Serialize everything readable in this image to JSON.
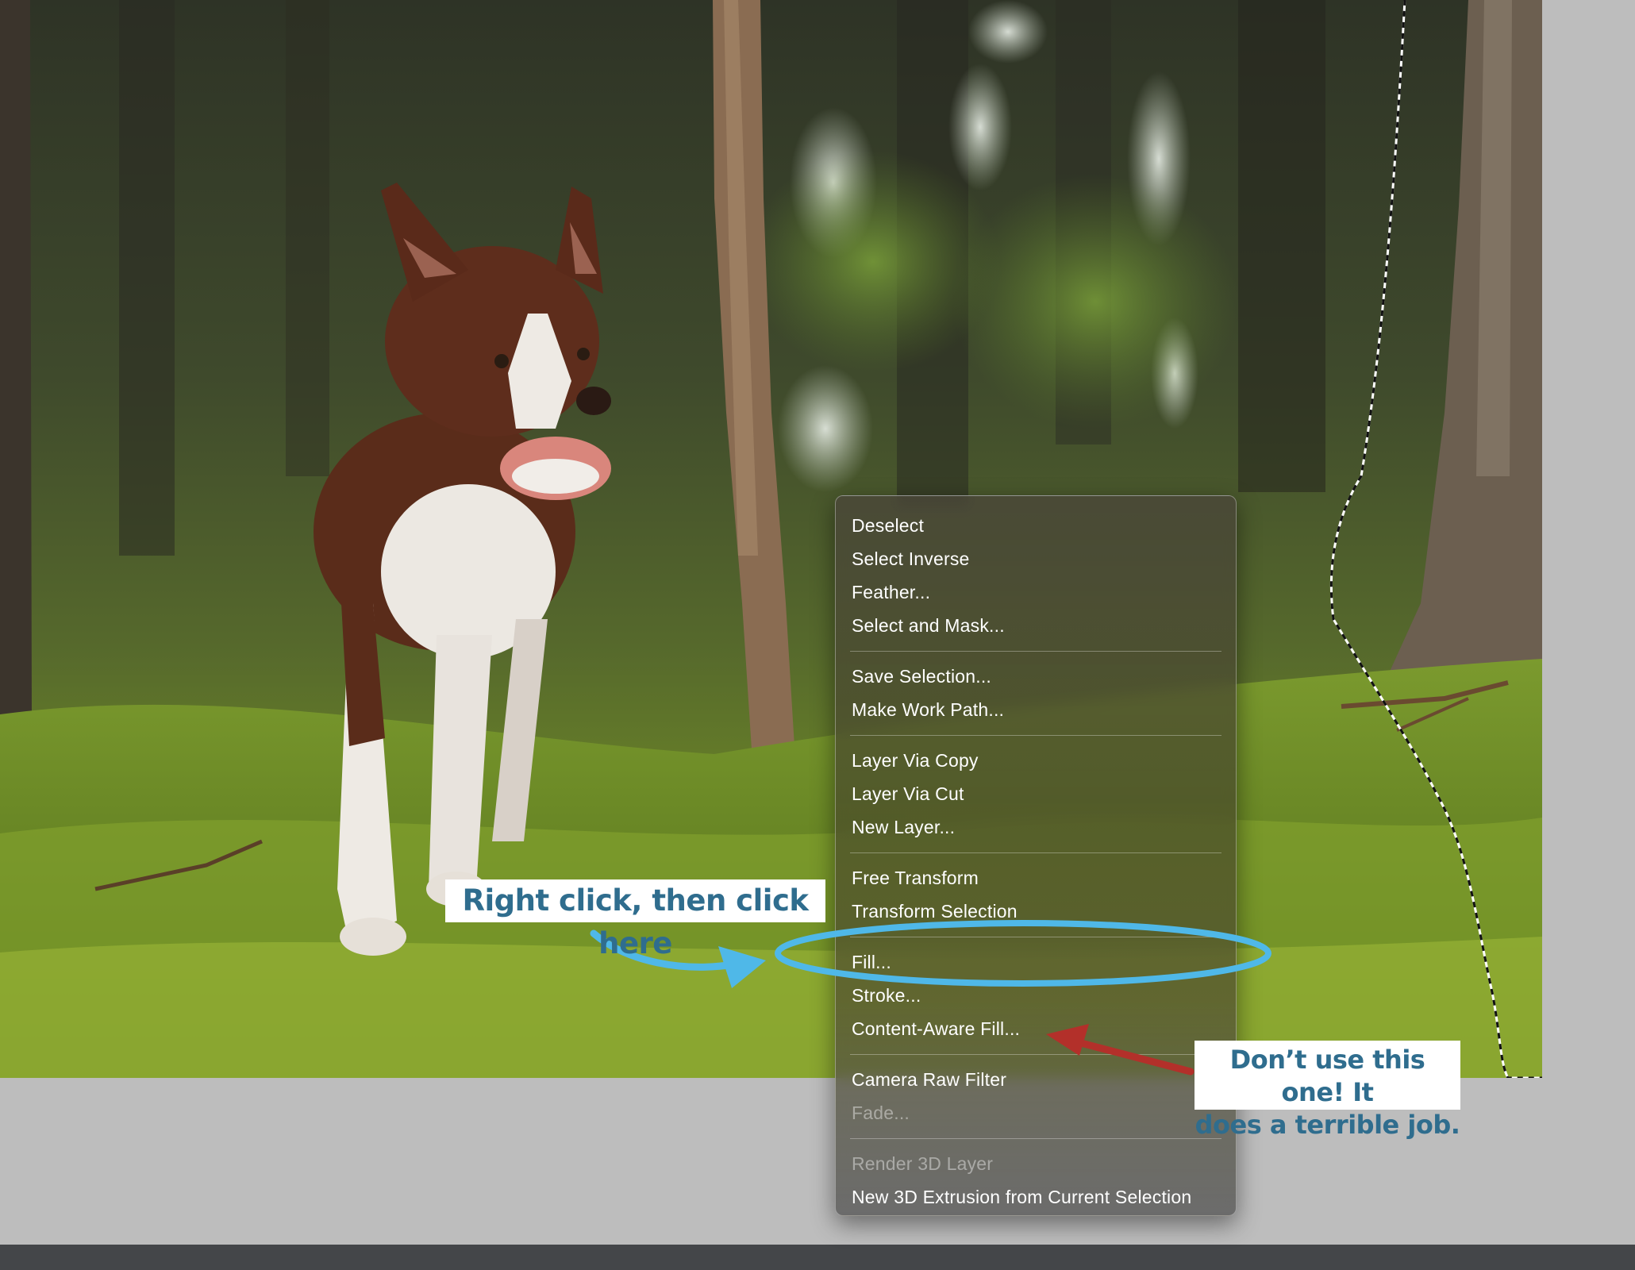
{
  "menu": {
    "groups": [
      [
        {
          "label": "Deselect",
          "enabled": true
        },
        {
          "label": "Select Inverse",
          "enabled": true
        },
        {
          "label": "Feather...",
          "enabled": true
        },
        {
          "label": "Select and Mask...",
          "enabled": true
        }
      ],
      [
        {
          "label": "Save Selection...",
          "enabled": true
        },
        {
          "label": "Make Work Path...",
          "enabled": true
        }
      ],
      [
        {
          "label": "Layer Via Copy",
          "enabled": true
        },
        {
          "label": "Layer Via Cut",
          "enabled": true
        },
        {
          "label": "New Layer...",
          "enabled": true
        }
      ],
      [
        {
          "label": "Free Transform",
          "enabled": true
        },
        {
          "label": "Transform Selection",
          "enabled": true
        }
      ],
      [
        {
          "label": "Fill...",
          "enabled": true
        },
        {
          "label": "Stroke...",
          "enabled": true
        },
        {
          "label": "Content-Aware Fill...",
          "enabled": true
        }
      ],
      [
        {
          "label": "Camera Raw Filter",
          "enabled": true
        },
        {
          "label": "Fade...",
          "enabled": false
        }
      ],
      [
        {
          "label": "Render 3D Layer",
          "enabled": false
        },
        {
          "label": "New 3D Extrusion from Current Selection",
          "enabled": true
        }
      ]
    ]
  },
  "annotations": {
    "right_click": "Right click, then click here",
    "warning_line1": "Don’t use this one! It",
    "warning_line2": "does a terrible job."
  },
  "colors": {
    "highlight_ellipse": "#4fb8e8",
    "warning_arrow": "#b3302a",
    "callout_text": "#2f6d8e",
    "canvas_bg": "#bdbdbd",
    "status_bar": "#444649"
  }
}
